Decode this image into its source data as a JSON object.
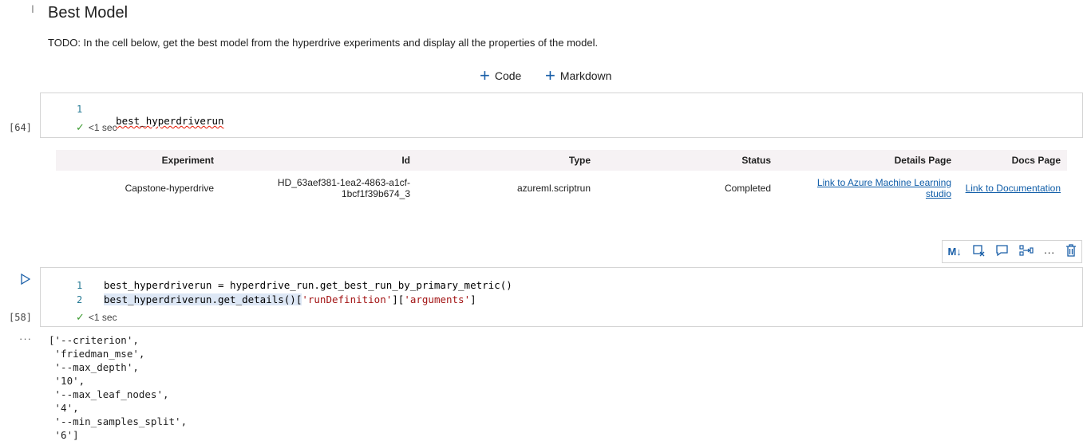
{
  "markdown": {
    "title": "Best Model",
    "text": "TODO: In the cell below, get the best model from the hyperdrive experiments and display all the properties of the model."
  },
  "add_cell": {
    "code_label": "Code",
    "markdown_label": "Markdown"
  },
  "cell1": {
    "exec_count": "[64]",
    "lines": [
      {
        "num": "1",
        "code": "best_hyperdriverun"
      }
    ],
    "status": "<1 sec"
  },
  "run_table": {
    "headers": [
      "Experiment",
      "Id",
      "Type",
      "Status",
      "Details Page",
      "Docs Page"
    ],
    "row": {
      "experiment": "Capstone-hyperdrive",
      "id_line1": "HD_63aef381-1ea2-4863-a1cf-",
      "id_line2": "1bcf1f39b674_3",
      "type": "azureml.scriptrun",
      "status": "Completed",
      "details_line1": "Link to Azure Machine Learning",
      "details_line2": "studio",
      "docs": "Link to Documentation"
    }
  },
  "toolbar": {
    "icons": [
      "markdown-icon",
      "clear-output-icon",
      "comment-icon",
      "split-cell-icon",
      "more-icon",
      "delete-icon"
    ]
  },
  "cell2": {
    "exec_count": "[58]",
    "line1_num": "1",
    "line1_code": "best_hyperdriverun = hyperdrive_run.get_best_run_by_primary_metric()",
    "line2_num": "2",
    "line2_code_a": "best_hyperdriverun.get_details()[",
    "line2_str1": "'runDefinition'",
    "line2_code_b": "][",
    "line2_str2": "'arguments'",
    "line2_code_c": "]",
    "status": "<1 sec"
  },
  "output": {
    "ellipsis": "···",
    "text": "['--criterion',\n 'friedman_mse',\n '--max_depth',\n '10',\n '--max_leaf_nodes',\n '4',\n '--min_samples_split',\n '6']"
  },
  "colors": {
    "accent": "#1a5fa8",
    "link": "#0f5da8",
    "success": "#3a9a2e",
    "header_bg": "#f6f2f4"
  }
}
